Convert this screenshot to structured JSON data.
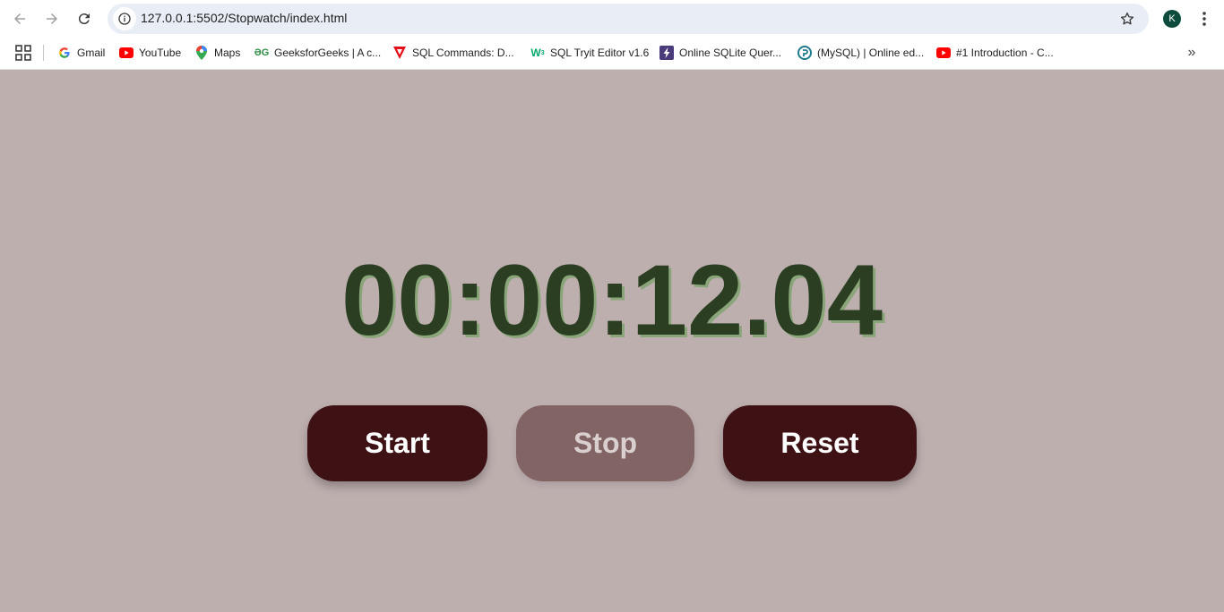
{
  "browser": {
    "url": "127.0.0.1:5502/Stopwatch/index.html",
    "profile_initial": "K",
    "bookmarks": [
      {
        "label": "Gmail",
        "icon": "google-icon"
      },
      {
        "label": "YouTube",
        "icon": "youtube-icon"
      },
      {
        "label": "Maps",
        "icon": "maps-icon"
      },
      {
        "label": "GeeksforGeeks | A c...",
        "icon": "geeksforgeeks-icon"
      },
      {
        "label": "SQL Commands: D...",
        "icon": "sql-commands-icon"
      },
      {
        "label": "SQL Tryit Editor v1.6",
        "icon": "w3schools-icon"
      },
      {
        "label": "Online SQLite Quer...",
        "icon": "sqlite-icon"
      },
      {
        "label": "(MySQL) | Online ed...",
        "icon": "mysql-online-icon"
      },
      {
        "label": "#1 Introduction - C...",
        "icon": "youtube-icon"
      }
    ]
  },
  "stopwatch": {
    "time": "00:00:12.04",
    "start_label": "Start",
    "stop_label": "Stop",
    "reset_label": "Reset"
  },
  "colors": {
    "page_background": "#beafaf",
    "timer_text": "#2b3e22",
    "timer_shadow": "#8aa57a",
    "button_active": "#3e1215",
    "button_disabled": "#826465"
  }
}
